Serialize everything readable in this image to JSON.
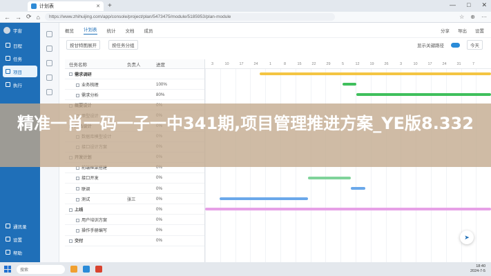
{
  "browser": {
    "tab_title": "计划表",
    "url": "https://www.zhihuijing.com/app/console/project/plan/5473475/module/5185953/plan-module",
    "nav": [
      "←",
      "→",
      "⟳",
      "⌂"
    ],
    "tools": [
      "☆",
      "⊕",
      "⋯"
    ],
    "window_controls": [
      "—",
      "□",
      "✕"
    ]
  },
  "sidebar": {
    "user": "宇宙",
    "items": [
      {
        "label": "日程",
        "icon": "calendar-icon"
      },
      {
        "label": "任务",
        "icon": "task-icon"
      },
      {
        "label": "项目",
        "icon": "project-icon",
        "active": true
      },
      {
        "label": "执行",
        "icon": "execute-icon"
      }
    ],
    "bottom_items": [
      {
        "label": "通讯录",
        "icon": "contacts-icon"
      },
      {
        "label": "设置",
        "icon": "gear-icon"
      },
      {
        "label": "帮助",
        "icon": "help-icon"
      }
    ]
  },
  "toptabs": {
    "items": [
      "概览",
      "计划表",
      "统计",
      "文档",
      "成员"
    ],
    "active_index": 1,
    "right": [
      "分享",
      "导出",
      "设置"
    ]
  },
  "toolbar": {
    "filter_label": "按甘特图展开",
    "group_label": "按任务分组",
    "right": [
      "显示关键路径",
      "今天"
    ]
  },
  "grid": {
    "headers": [
      "任务名称",
      "负责人",
      "进度"
    ],
    "rows": [
      {
        "name": "需求调研",
        "owner": "",
        "progress": "",
        "group": true
      },
      {
        "name": "业务梳理",
        "owner": "",
        "progress": "100%"
      },
      {
        "name": "需求分析",
        "owner": "",
        "progress": "80%"
      },
      {
        "name": "概要设计",
        "owner": "",
        "progress": "0%",
        "group": true
      },
      {
        "name": "原型设计",
        "owner": "",
        "progress": "0%"
      },
      {
        "name": "产品设计",
        "owner": "",
        "progress": "0%",
        "group": true
      },
      {
        "name": "数据库模型设计",
        "owner": "",
        "progress": "0%"
      },
      {
        "name": "接口设计方案",
        "owner": "",
        "progress": "0%"
      },
      {
        "name": "开发计划",
        "owner": "",
        "progress": "0%",
        "group": true
      },
      {
        "name": "前端框架搭建",
        "owner": "",
        "progress": "0%"
      },
      {
        "name": "接口开发",
        "owner": "",
        "progress": "0%"
      },
      {
        "name": "联调",
        "owner": "",
        "progress": "0%"
      },
      {
        "name": "测试",
        "owner": "张三",
        "progress": "0%"
      },
      {
        "name": "上线",
        "owner": "",
        "progress": "0%",
        "group": true
      },
      {
        "name": "用户培训方案",
        "owner": "",
        "progress": "0%"
      },
      {
        "name": "操作手册编写",
        "owner": "",
        "progress": "0%"
      },
      {
        "name": "交付",
        "owner": "",
        "progress": "0%",
        "group": true
      }
    ]
  },
  "gantt": {
    "dates": [
      "3",
      "10",
      "17",
      "24",
      "1",
      "8",
      "15",
      "22",
      "29",
      "5",
      "12",
      "19",
      "26",
      "3",
      "10",
      "17",
      "24",
      "31",
      "7"
    ],
    "tasks": [
      {
        "row": 0,
        "start": 0.19,
        "end": 1.0,
        "color": "#f4c542"
      },
      {
        "row": 1,
        "start": 0.48,
        "end": 0.53,
        "color": "#3fbf5c"
      },
      {
        "row": 2,
        "start": 0.53,
        "end": 1.0,
        "color": "#3fbf5c"
      },
      {
        "row": 10,
        "start": 0.36,
        "end": 0.51,
        "color": "#7fd39a"
      },
      {
        "row": 11,
        "start": 0.51,
        "end": 0.56,
        "color": "#6aa8ea"
      },
      {
        "row": 12,
        "start": 0.05,
        "end": 0.36,
        "color": "#6aa8ea"
      },
      {
        "row": 13,
        "start": 0.0,
        "end": 1.0,
        "color": "#e6a0e6"
      }
    ],
    "colors": {
      "accent": "#1f6fb8"
    }
  },
  "headline": "精准一肖一码一子一中341期,项目管理推进方案_YE版8.332",
  "taskbar": {
    "search_placeholder": "搜索",
    "time": "18:40",
    "date": "2024-7-5"
  }
}
